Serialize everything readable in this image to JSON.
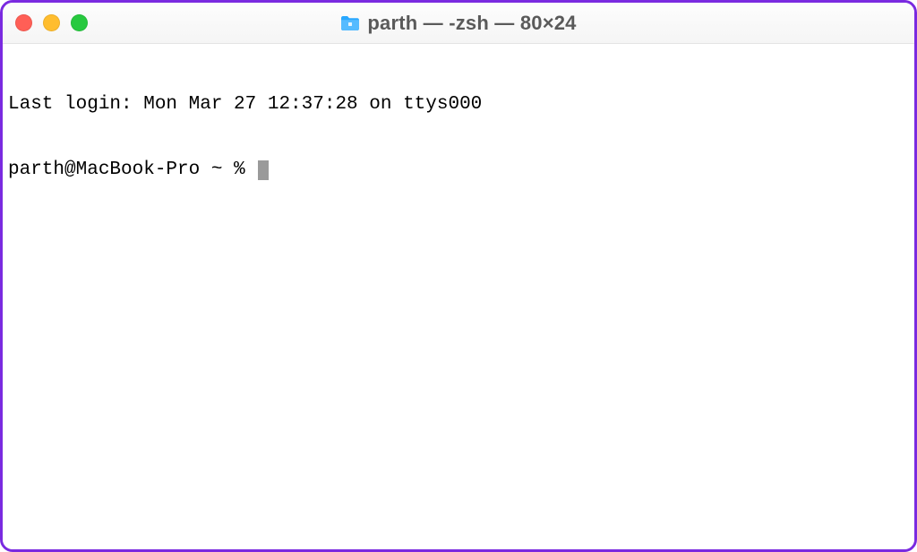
{
  "window": {
    "title": "parth — -zsh — 80×24"
  },
  "terminal": {
    "last_login_line": "Last login: Mon Mar 27 12:37:28 on ttys000",
    "prompt": "parth@MacBook-Pro ~ % "
  }
}
